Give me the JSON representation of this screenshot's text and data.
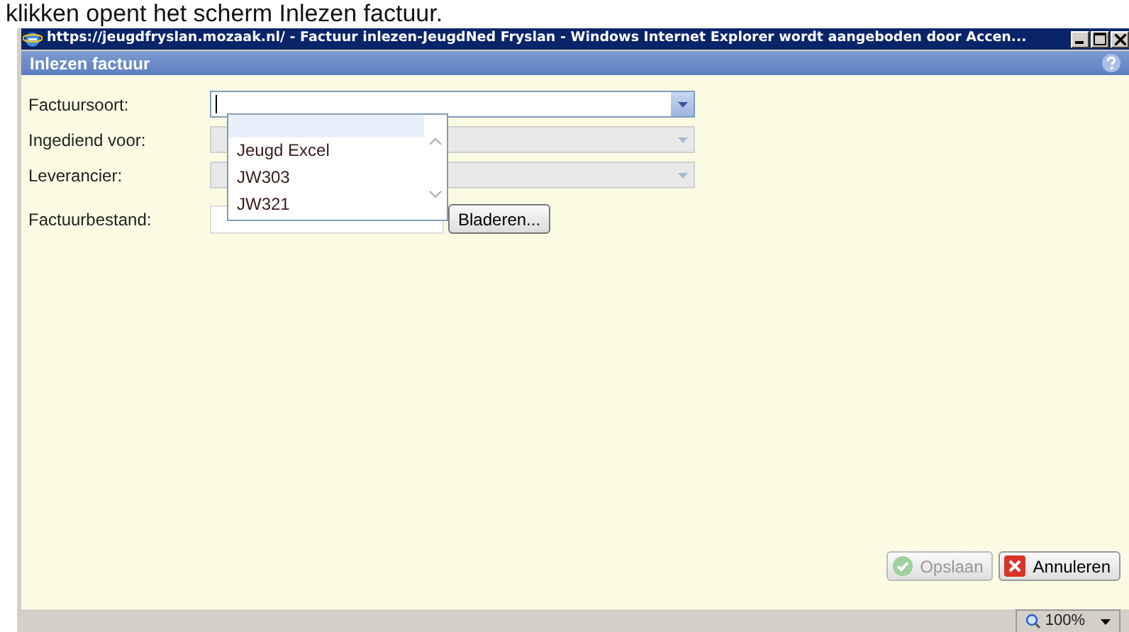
{
  "caption": "klikken opent het scherm Inlezen factuur.",
  "window": {
    "title": "https://jeugdfryslan.mozaak.nl/ - Factuur inlezen-JeugdNed Fryslan - Windows Internet Explorer wordt aangeboden door Accen..."
  },
  "dialog": {
    "title": "Inlezen factuur"
  },
  "fields": [
    {
      "kind": "select",
      "label": "Factuursoort:",
      "disabled": false
    },
    {
      "kind": "select",
      "label": "Ingediend voor:",
      "disabled": true
    },
    {
      "kind": "select",
      "label": "Leverancier:",
      "disabled": true
    },
    {
      "kind": "file",
      "label": "Factuurbestand:",
      "button": "Bladeren..."
    }
  ],
  "dropdown": {
    "options": [
      {
        "selected": true
      },
      {
        "label": "Jeugd Excel",
        "selected": false
      },
      {
        "label": "JW303",
        "selected": false
      },
      {
        "label": "JW321",
        "selected": false
      }
    ]
  },
  "buttons": [
    {
      "kind": "save",
      "label": "Opslaan",
      "disabled": true
    },
    {
      "kind": "cancel",
      "label": "Annuleren",
      "disabled": false
    }
  ],
  "status_bar": {
    "zoom": "100%"
  }
}
